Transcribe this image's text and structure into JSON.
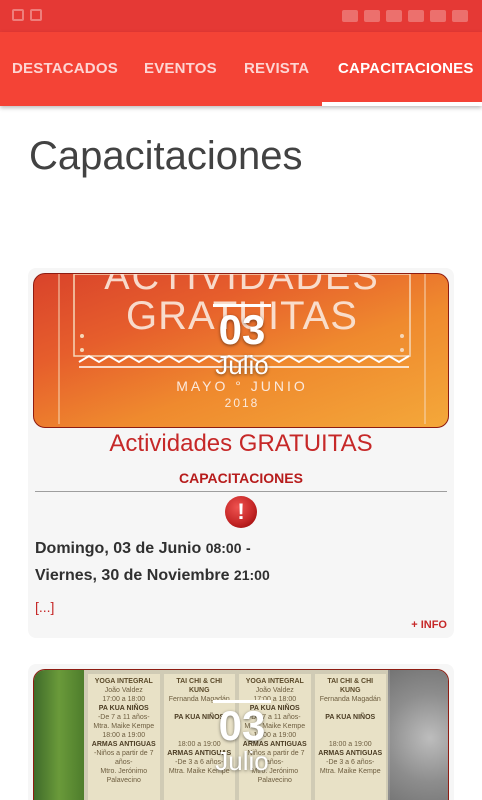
{
  "tabs": [
    {
      "label": "DESTACADOS",
      "active": false
    },
    {
      "label": "EVENTOS",
      "active": false
    },
    {
      "label": "REVISTA",
      "active": false
    },
    {
      "label": "CAPACITACIONES",
      "active": true
    }
  ],
  "page": {
    "title": "Capacitaciones"
  },
  "cards": [
    {
      "banner": {
        "line1": "ACTIVIDADES",
        "line2": "GRATUITAS",
        "subtitle": "MAYO ° JUNIO",
        "year": "2018"
      },
      "day": "03",
      "month": "Julio",
      "title": "Actividades GRATUITAS",
      "category": "CAPACITACIONES",
      "start_date": "Domingo, 03 de Junio",
      "start_time": "08:00",
      "start_sep": "-",
      "end_date": "Viernes, 30 de Noviembre",
      "end_time": "21:00",
      "excerpt": "[...]",
      "more_label": "+ INFO"
    },
    {
      "day": "03",
      "month": "Julio",
      "schedule": {
        "headers": [
          "YOGA INTEGRAL",
          "TAI CHI & CHI KUNG",
          "YOGA INTEGRAL",
          "TAI CHI & CHI KUNG"
        ],
        "teachers": [
          "João Valdez",
          "Fernanda Magadán",
          "João Valdez",
          "Fernanda Magadán"
        ],
        "time1": [
          "17:00 a 18:00",
          "",
          "17:00 a 18:00",
          ""
        ],
        "class1": [
          "PA KUA NIÑOS",
          "PA KUA NIÑOS",
          "PA KUA NIÑOS",
          "PA KUA NIÑOS"
        ],
        "age1": [
          "-De 7 a 11 años-",
          "",
          "-De 7 a 11 años-",
          ""
        ],
        "teacher1": [
          "Mtra. Maike Kempe",
          "",
          "Mtra. Maike Kempe",
          ""
        ],
        "time2": [
          "18:00 a 19:00",
          "18:00 a 19:00",
          "18:00 a 19:00",
          "18:00 a 19:00"
        ],
        "class2": [
          "ARMAS ANTIGUAS",
          "ARMAS ANTIGUAS",
          "ARMAS ANTIGUAS",
          "ARMAS ANTIGUAS"
        ],
        "age2": [
          "-Niños a partir de 7 años-",
          "-De 3 a 6 años-",
          "-Niños a partir de 7 años-",
          "-De 3 a 6 años-"
        ],
        "teacher2": [
          "Mtro. Jerónimo Palavecino",
          "Mtra. Maike Kempe",
          "Mtro. Jerónimo Palavecino",
          "Mtra. Maike Kempe"
        ]
      }
    }
  ],
  "colors": {
    "primary": "#f44336",
    "status": "#e53935",
    "accent": "#c62828"
  }
}
